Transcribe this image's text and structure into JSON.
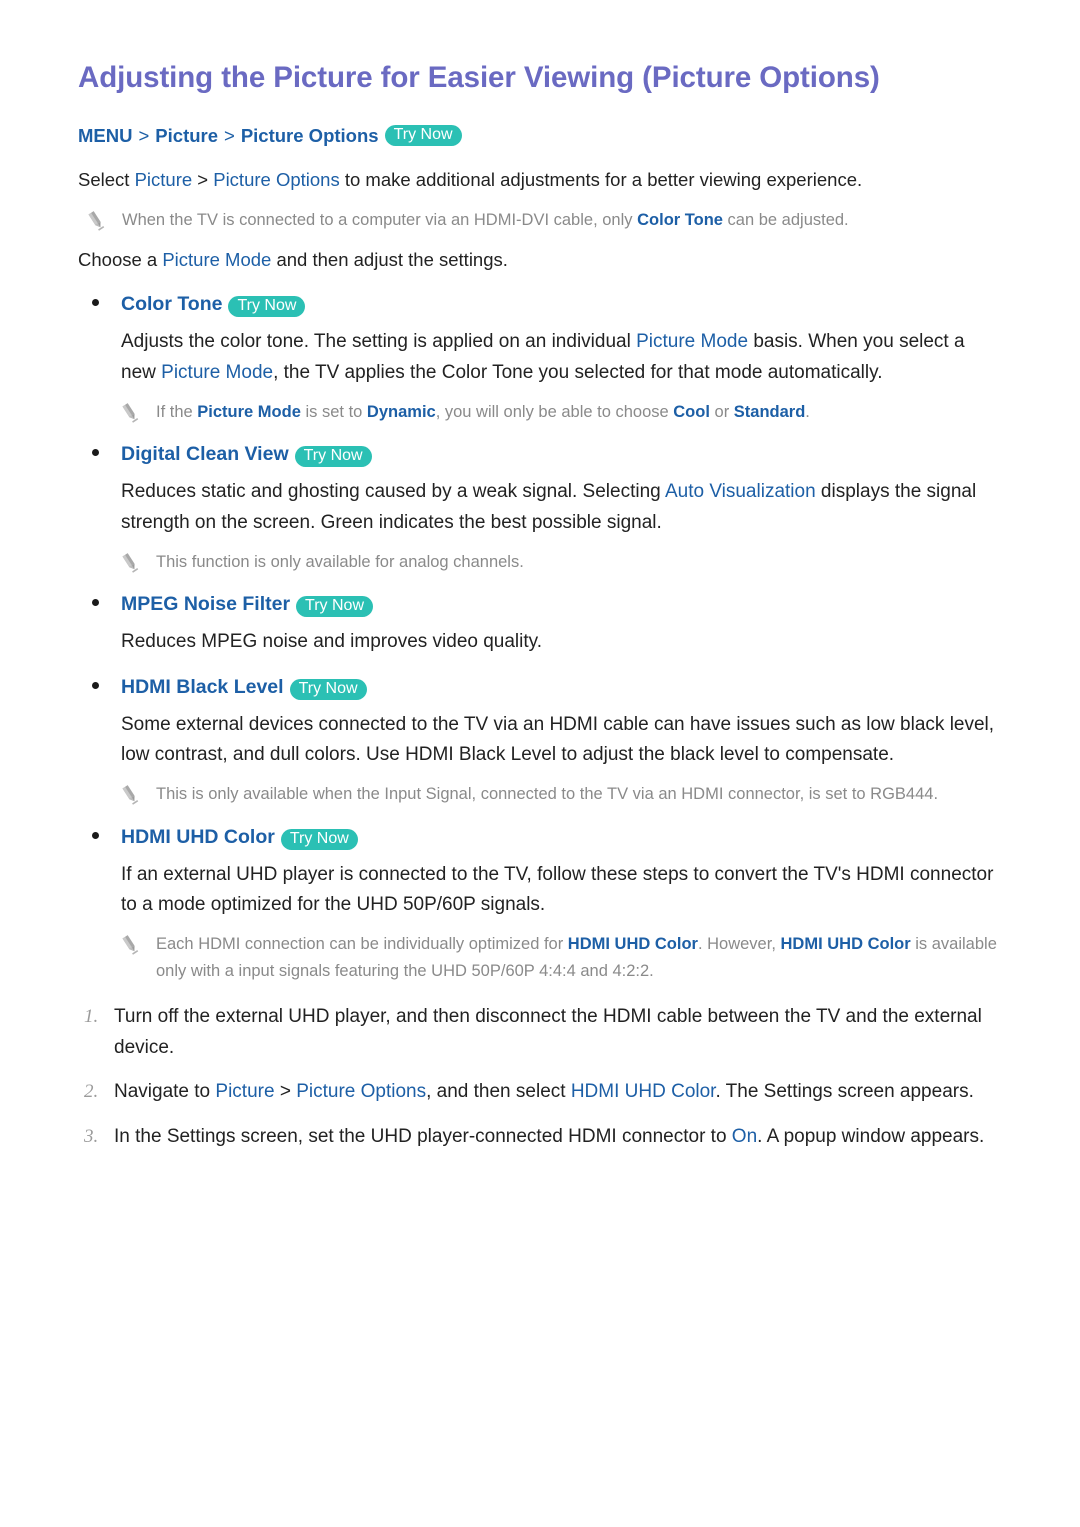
{
  "title": "Adjusting the Picture for Easier Viewing (Picture Options)",
  "colors": {
    "title": "#6a6ac2",
    "link": "#1d5fa6",
    "badge_bg": "#2bc0b4",
    "badge_text": "#ffffff",
    "note_text": "#8a8a8a",
    "body_text": "#222222",
    "step_number": "#9b9b9b"
  },
  "badge": {
    "label": "Try Now"
  },
  "breadcrumb": {
    "items": [
      "MENU",
      "Picture",
      "Picture Options"
    ],
    "separator": ">"
  },
  "intro": {
    "pre": "Select ",
    "link1": "Picture",
    "sep": " > ",
    "link2": "Picture Options",
    "post": " to make additional adjustments for a better viewing experience."
  },
  "note_top": {
    "pre": "When the TV is connected to a computer via an HDMI-DVI cable, only ",
    "link": "Color Tone",
    "post": " can be adjusted."
  },
  "choose": {
    "pre": "Choose a ",
    "link": "Picture Mode",
    "post": " and then adjust the settings."
  },
  "options": [
    {
      "label": "Color Tone",
      "has_badge": true,
      "body": {
        "p1_a": "Adjusts the color tone. The setting is applied on an individual ",
        "p1_link1": "Picture Mode",
        "p1_b": " basis. When you select a new ",
        "p1_link2": "Picture Mode",
        "p1_c": ", the TV applies the Color Tone you selected for that mode automatically."
      },
      "note": {
        "a": "If the ",
        "link1": "Picture Mode",
        "b": " is set to ",
        "link2": "Dynamic",
        "c": ", you will only be able to choose ",
        "link3": "Cool",
        "d": " or ",
        "link4": "Standard",
        "e": "."
      }
    },
    {
      "label": "Digital Clean View",
      "has_badge": true,
      "body": {
        "p1_a": "Reduces static and ghosting caused by a weak signal. Selecting ",
        "p1_link1": "Auto Visualization",
        "p1_b": " displays the signal strength on the screen. Green indicates the best possible signal."
      },
      "note": {
        "a": "This function is only available for analog channels."
      }
    },
    {
      "label": "MPEG Noise Filter",
      "has_badge": true,
      "body": {
        "p1_a": "Reduces MPEG noise and improves video quality."
      }
    },
    {
      "label": "HDMI Black Level",
      "has_badge": true,
      "body": {
        "p1_a": "Some external devices connected to the TV via an HDMI cable can have issues such as low black level, low contrast, and dull colors. Use HDMI Black Level to adjust the black level to compensate."
      },
      "note": {
        "a": "This is only available when the Input Signal, connected to the TV via an HDMI connector, is set to RGB444."
      }
    },
    {
      "label": "HDMI UHD Color",
      "has_badge": true,
      "body": {
        "p1_a": "If an external UHD player is connected to the TV, follow these steps to convert the TV's HDMI connector to a mode optimized for the UHD 50P/60P signals."
      },
      "note": {
        "a": "Each HDMI connection can be individually optimized for ",
        "link1": "HDMI UHD Color",
        "b": ". However, ",
        "link2": "HDMI UHD Color",
        "c": " is available only with a input signals featuring the UHD 50P/60P 4:4:4 and 4:2:2."
      }
    }
  ],
  "steps": [
    {
      "num": "1.",
      "a": "Turn off the external UHD player, and then disconnect the HDMI cable between the TV and the external device."
    },
    {
      "num": "2.",
      "a": "Navigate to ",
      "link1": "Picture",
      "b": " > ",
      "link2": "Picture Options",
      "c": ", and then select ",
      "link3": "HDMI UHD Color",
      "d": ". The Settings screen appears."
    },
    {
      "num": "3.",
      "a": "In the Settings screen, set the UHD player-connected HDMI connector to ",
      "link1": "On",
      "b": ". A popup window appears."
    }
  ]
}
